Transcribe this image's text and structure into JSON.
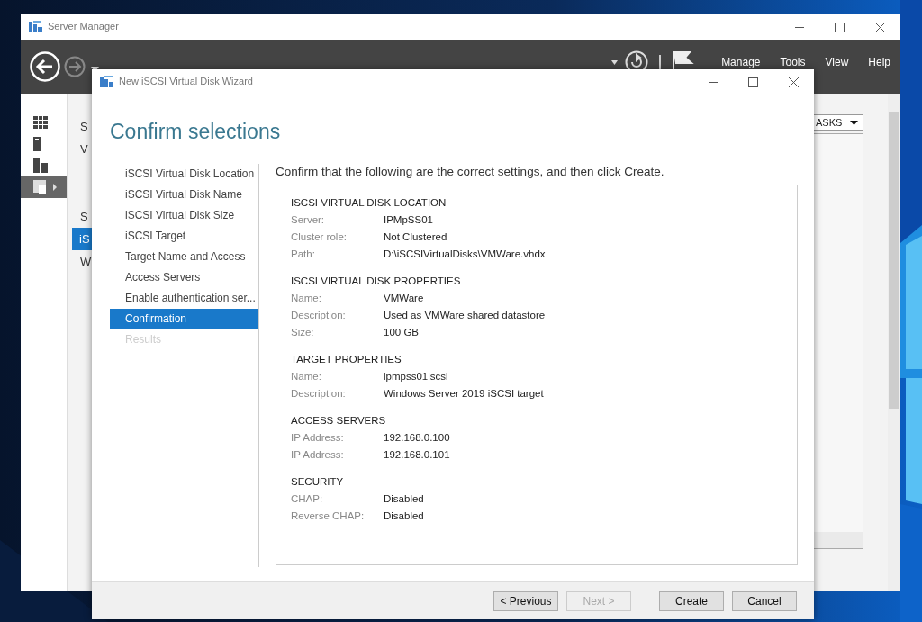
{
  "server_manager": {
    "title": "Server Manager",
    "menu": [
      "Manage",
      "Tools",
      "View",
      "Help"
    ],
    "nav": [
      {
        "kind": "dashboard",
        "selected": false
      },
      {
        "kind": "server",
        "selected": false
      },
      {
        "kind": "servers",
        "selected": false
      },
      {
        "kind": "storage",
        "selected": true
      }
    ],
    "pane_groups": [
      {
        "items": [
          {
            "label": "S",
            "selected": false
          },
          {
            "label": "V",
            "selected": false
          }
        ]
      },
      {
        "items": [
          {
            "label": "S",
            "selected": false
          },
          {
            "label": "iS",
            "selected": true
          },
          {
            "label": "W",
            "selected": false
          }
        ]
      }
    ],
    "tasks_label": "ASKS"
  },
  "wizard": {
    "title": "New iSCSI Virtual Disk Wizard",
    "heading": "Confirm selections",
    "steps": [
      {
        "label": "iSCSI Virtual Disk Location",
        "selected": false,
        "disabled": false
      },
      {
        "label": "iSCSI Virtual Disk Name",
        "selected": false,
        "disabled": false
      },
      {
        "label": "iSCSI Virtual Disk Size",
        "selected": false,
        "disabled": false
      },
      {
        "label": "iSCSI Target",
        "selected": false,
        "disabled": false
      },
      {
        "label": "Target Name and Access",
        "selected": false,
        "disabled": false
      },
      {
        "label": "Access Servers",
        "selected": false,
        "disabled": false
      },
      {
        "label": "Enable authentication ser...",
        "selected": false,
        "disabled": false
      },
      {
        "label": "Confirmation",
        "selected": true,
        "disabled": false
      },
      {
        "label": "Results",
        "selected": false,
        "disabled": true
      }
    ],
    "intro": "Confirm that the following are the correct settings, and then click Create.",
    "sections": [
      {
        "heading": "ISCSI VIRTUAL DISK LOCATION",
        "rows": [
          {
            "label": "Server:",
            "value": "IPMpSS01"
          },
          {
            "label": "Cluster role:",
            "value": "Not Clustered"
          },
          {
            "label": "Path:",
            "value": "D:\\iSCSIVirtualDisks\\VMWare.vhdx"
          }
        ]
      },
      {
        "heading": "ISCSI VIRTUAL DISK PROPERTIES",
        "rows": [
          {
            "label": "Name:",
            "value": "VMWare"
          },
          {
            "label": "Description:",
            "value": "Used as VMWare shared datastore"
          },
          {
            "label": "Size:",
            "value": "100 GB"
          }
        ]
      },
      {
        "heading": "TARGET PROPERTIES",
        "rows": [
          {
            "label": "Name:",
            "value": "ipmpss01iscsi"
          },
          {
            "label": "Description:",
            "value": "Windows Server 2019 iSCSI target"
          }
        ]
      },
      {
        "heading": "ACCESS SERVERS",
        "rows": [
          {
            "label": "IP Address:",
            "value": "192.168.0.100"
          },
          {
            "label": "IP Address:",
            "value": "192.168.0.101"
          }
        ]
      },
      {
        "heading": "SECURITY",
        "rows": [
          {
            "label": "CHAP:",
            "value": "Disabled"
          },
          {
            "label": "Reverse CHAP:",
            "value": "Disabled"
          }
        ]
      }
    ],
    "buttons": [
      {
        "label": "< Previous",
        "disabled": false
      },
      {
        "label": "Next >",
        "disabled": true
      },
      {
        "label": "Create",
        "disabled": false
      },
      {
        "label": "Cancel",
        "disabled": false
      }
    ]
  }
}
